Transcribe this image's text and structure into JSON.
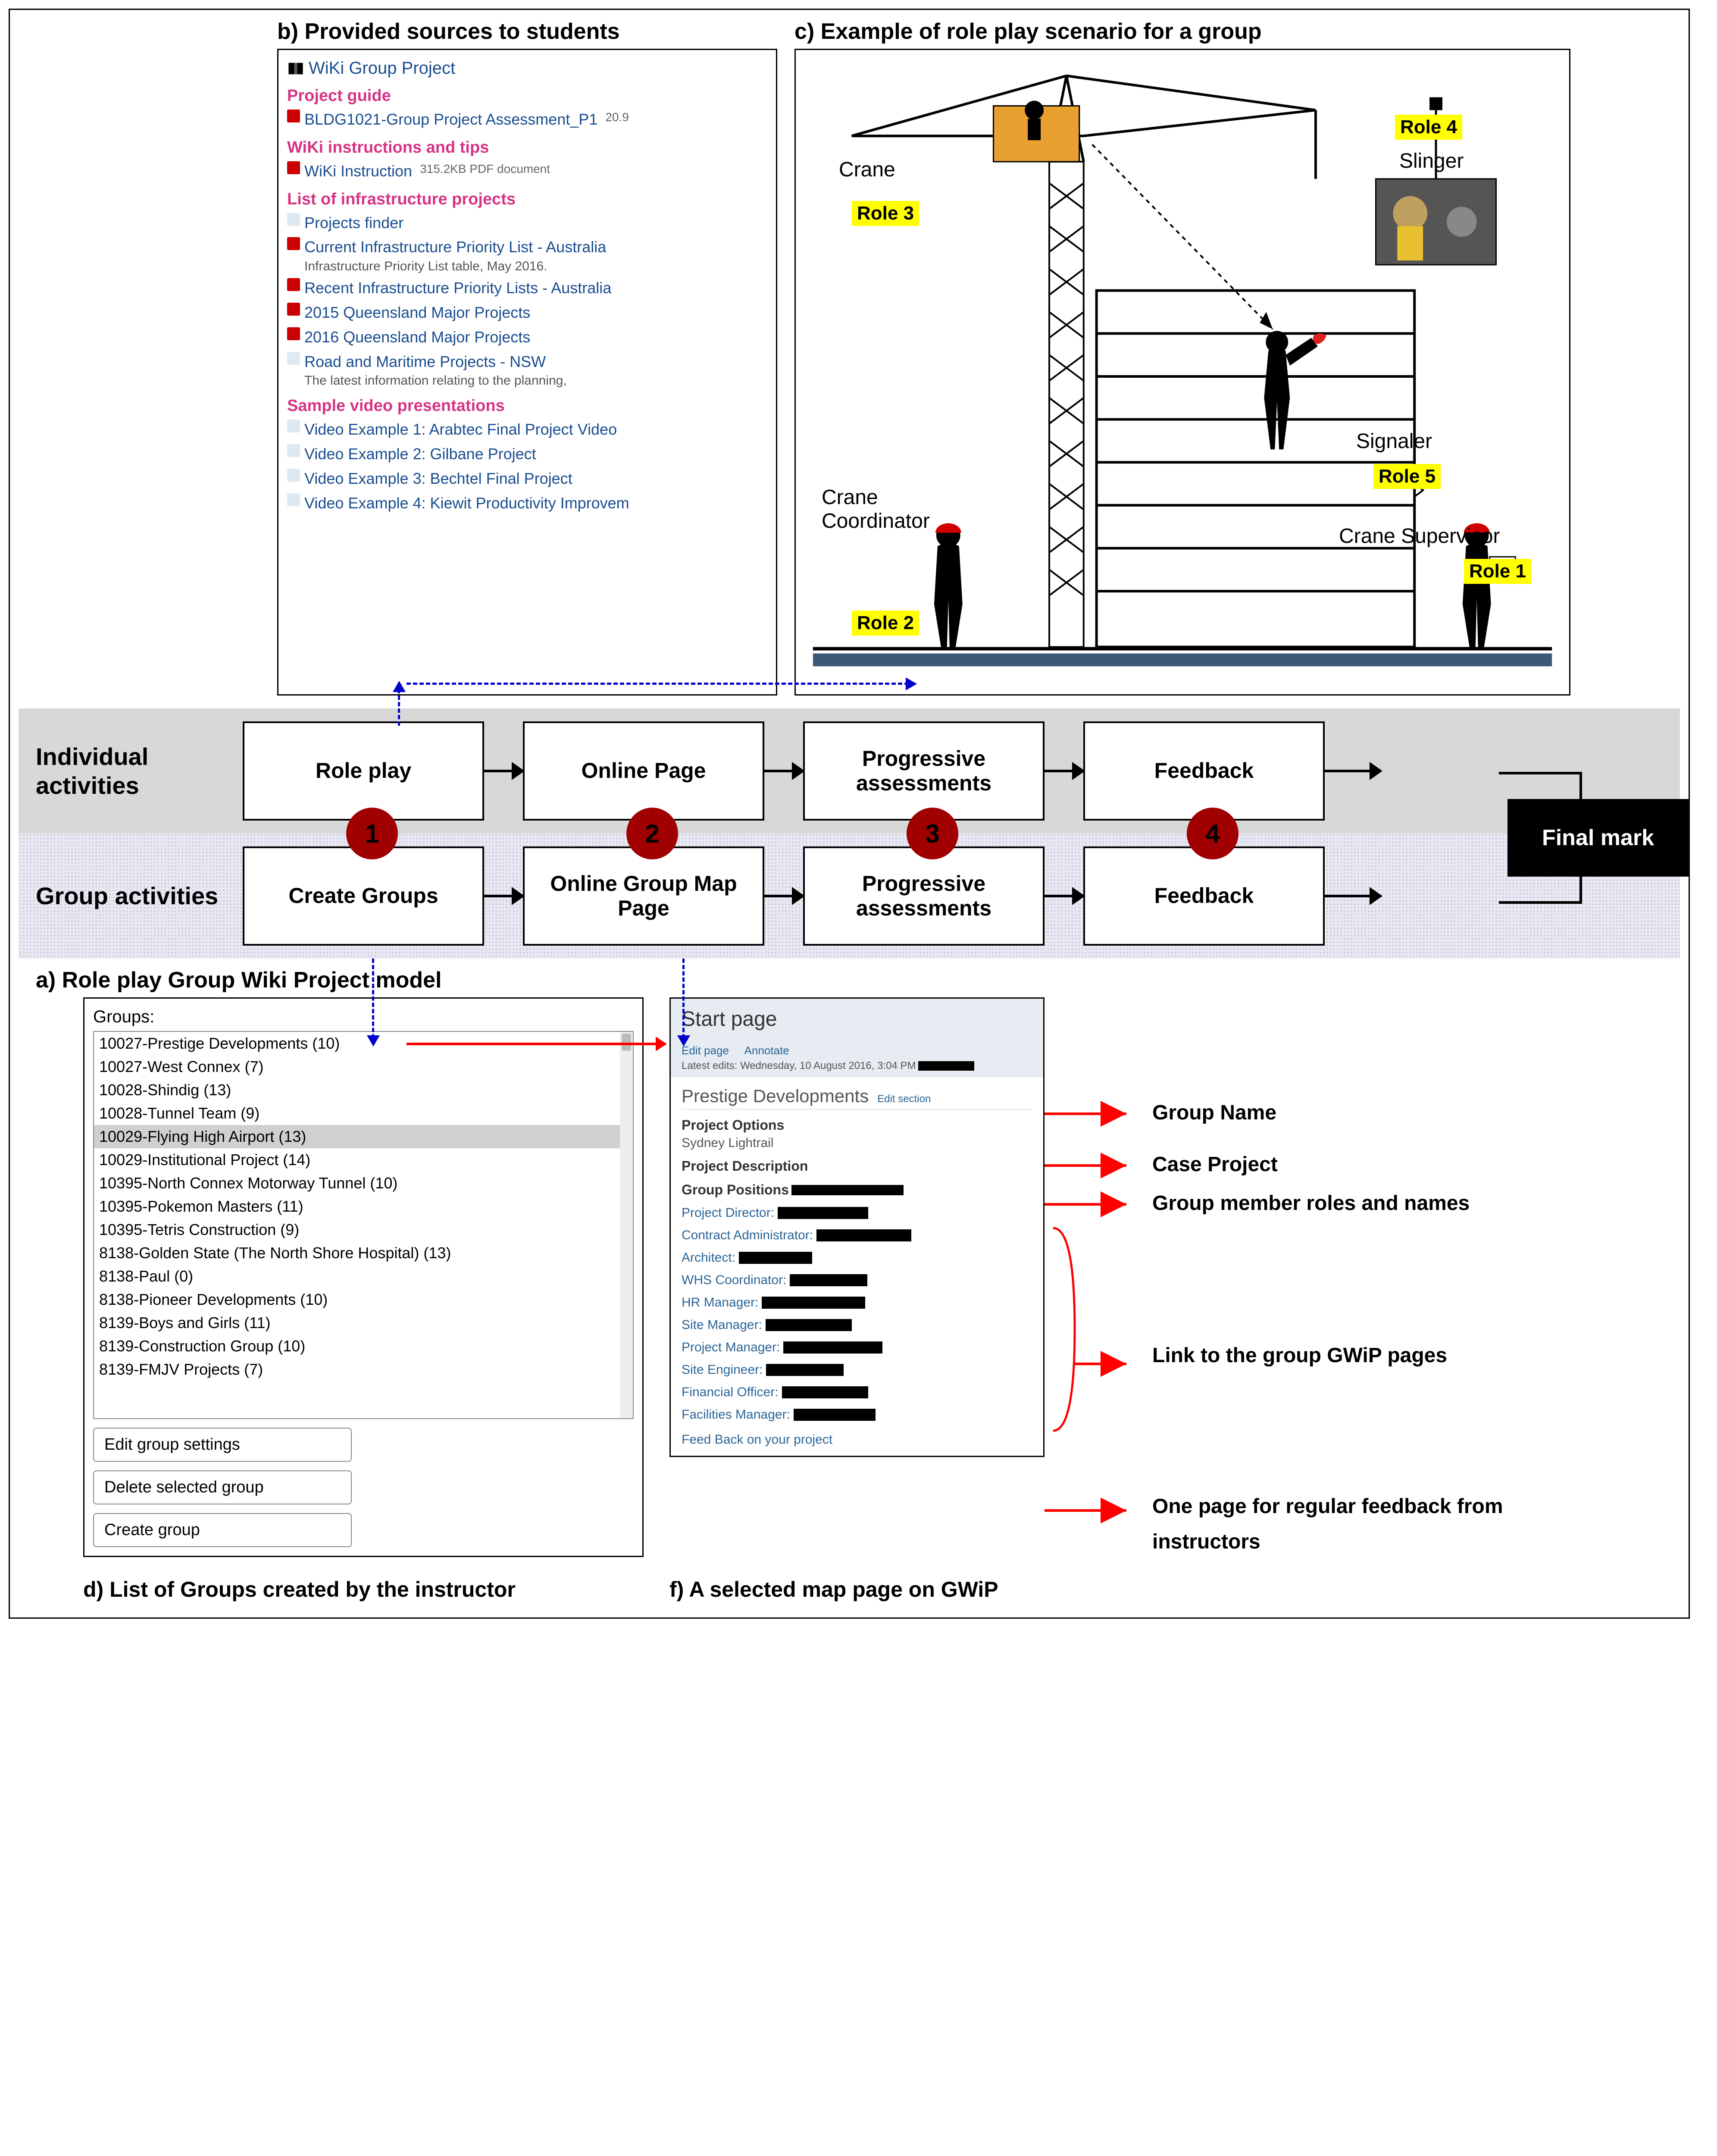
{
  "panels": {
    "b": {
      "heading": "b) Provided sources to students",
      "wikiTitle": "WiKi Group Project",
      "sections": [
        {
          "title": "Project guide",
          "items": [
            {
              "icon": "pdf",
              "label": "BLDG1021-Group Project Assessment_P1",
              "meta": "20.9"
            }
          ]
        },
        {
          "title": "WiKi instructions and tips",
          "items": [
            {
              "icon": "pdf",
              "label": "WiKi Instruction",
              "meta": "315.2KB PDF document"
            }
          ]
        },
        {
          "title": "List of infrastructure projects",
          "items": [
            {
              "icon": "doc",
              "label": "Projects finder"
            },
            {
              "icon": "pdf",
              "label": "Current Infrastructure Priority List - Australia",
              "sub": "Infrastructure Priority List table, May 2016."
            },
            {
              "icon": "pdf",
              "label": "Recent Infrastructure Priority Lists - Australia"
            },
            {
              "icon": "pdf",
              "label": "2015 Queensland Major Projects"
            },
            {
              "icon": "pdf",
              "label": "2016 Queensland Major Projects"
            },
            {
              "icon": "doc",
              "label": "Road and Maritime Projects - NSW",
              "sub": "The latest information relating to the planning,"
            }
          ]
        },
        {
          "title": "Sample video presentations",
          "items": [
            {
              "icon": "doc",
              "label": "Video Example 1: Arabtec Final Project Video"
            },
            {
              "icon": "doc",
              "label": "Video Example 2: Gilbane Project"
            },
            {
              "icon": "doc",
              "label": "Video Example 3: Bechtel Final Project"
            },
            {
              "icon": "doc",
              "label": "Video Example 4: Kiewit Productivity Improvem"
            }
          ]
        }
      ]
    },
    "c": {
      "heading": "c) Example of role play scenario for a group",
      "labels": {
        "crane": "Crane",
        "slinger": "Slinger",
        "signaler": "Signaler",
        "craneCoord": "Crane\nCoordinator",
        "craneSuper": "Crane Supervisor"
      },
      "roles": [
        "Role 1",
        "Role 2",
        "Role 3",
        "Role 4",
        "Role 5"
      ]
    }
  },
  "flow": {
    "individualLabel": "Individual activities",
    "groupLabel": "Group activities",
    "individualBoxes": [
      "Role play",
      "Online Page",
      "Progressive assessments",
      "Feedback"
    ],
    "groupBoxes": [
      "Create Groups",
      "Online Group Map Page",
      "Progressive assessments",
      "Feedback"
    ],
    "numbers": [
      "1",
      "2",
      "3",
      "4"
    ],
    "finalMark": "Final mark",
    "captionA": "a) Role play Group Wiki Project model"
  },
  "panelD": {
    "groupsLabel": "Groups:",
    "groups": [
      "10027-Prestige Developments (10)",
      "10027-West Connex (7)",
      "10028-Shindig (13)",
      "10028-Tunnel Team (9)",
      "10029-Flying High Airport (13)",
      "10029-Institutional Project (14)",
      "10395-North Connex Motorway Tunnel (10)",
      "10395-Pokemon Masters (11)",
      "10395-Tetris Construction (9)",
      "8138-Golden State (The North Shore Hospital) (13)",
      "8138-Paul (0)",
      "8138-Pioneer Developments (10)",
      "8139-Boys and Girls (11)",
      "8139-Construction Group (10)",
      "8139-FMJV Projects (7)"
    ],
    "selectedIndex": 4,
    "buttons": [
      "Edit group settings",
      "Delete selected group",
      "Create group"
    ],
    "caption": "d) List of Groups created by the instructor"
  },
  "panelF": {
    "startPage": "Start page",
    "actions": [
      "Edit page",
      "Annotate"
    ],
    "latestEdits": "Latest edits: Wednesday, 10 August 2016, 3:04 PM",
    "groupName": "Prestige Developments",
    "editSection": "Edit section",
    "projectOptionsLabel": "Project Options",
    "projectOptions": "Sydney Lightrail",
    "projectDescLabel": "Project Description",
    "groupPositionsLabel": "Group Positions",
    "positions": [
      "Project Director:",
      "Contract Administrator:",
      "Architect:",
      "WHS Coordinator:",
      "HR Manager:",
      "Site Manager:",
      "Project Manager:",
      "Site Engineer:",
      "Financial Officer:",
      "Facilities Manager:"
    ],
    "feedbackLink": "Feed Back on your project",
    "caption": "f) A selected map page on GWiP",
    "annotations": {
      "groupName": "Group Name",
      "caseProject": "Case Project",
      "memberRoles": "Group member roles and names",
      "linkPages": "Link to the group GWiP pages",
      "feedbackPage": "One page for regular feedback from instructors"
    }
  }
}
